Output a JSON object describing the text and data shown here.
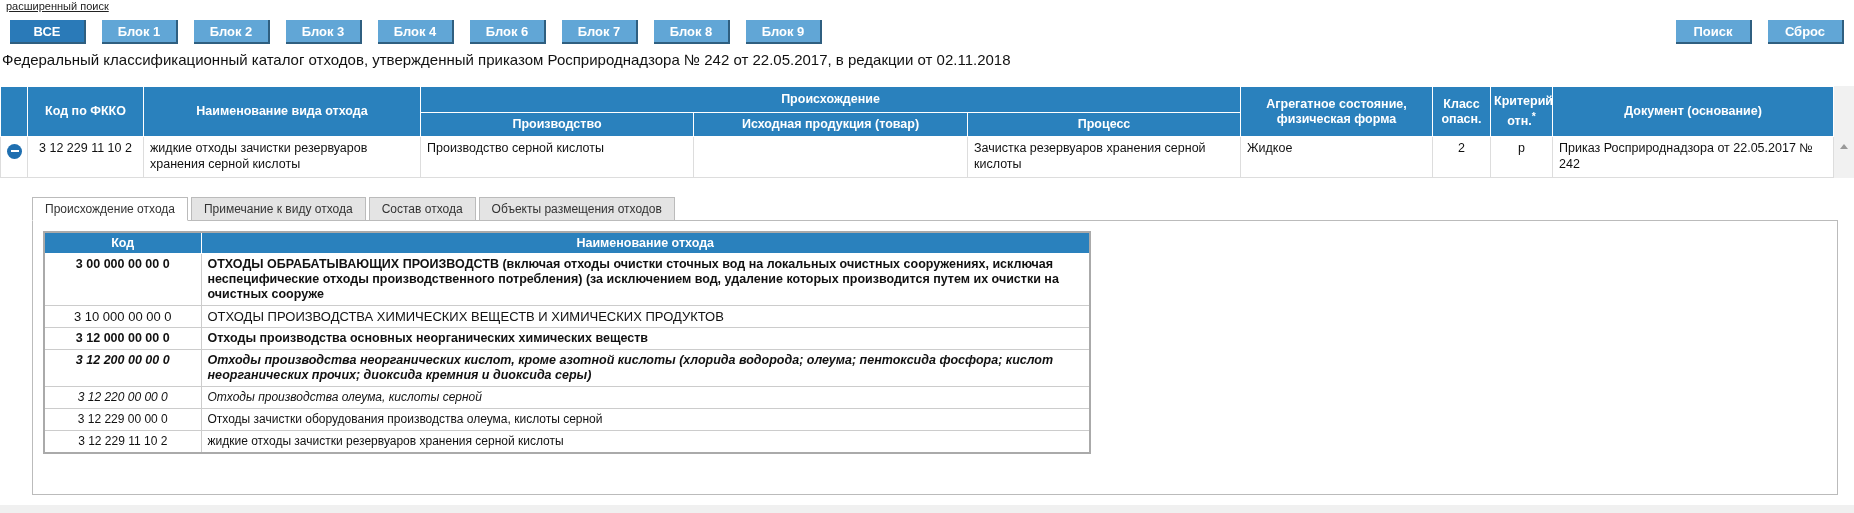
{
  "advanced_search_link": "расширенный поиск",
  "block_buttons": [
    {
      "label": "ВСЕ",
      "selected": true
    },
    {
      "label": "Блок 1",
      "selected": false
    },
    {
      "label": "Блок 2",
      "selected": false
    },
    {
      "label": "Блок 3",
      "selected": false
    },
    {
      "label": "Блок 4",
      "selected": false
    },
    {
      "label": "Блок 6",
      "selected": false
    },
    {
      "label": "Блок 7",
      "selected": false
    },
    {
      "label": "Блок 8",
      "selected": false
    },
    {
      "label": "Блок 9",
      "selected": false
    }
  ],
  "action_buttons": [
    "Поиск",
    "Сброс"
  ],
  "catalog_title": "Федеральный классификационный каталог отходов, утвержденный приказом Росприроднадзора № 242 от 22.05.2017, в редакции от 02.11.2018",
  "main_table": {
    "columns": {
      "code": "Код по ФККО",
      "name": "Наименование вида отхода",
      "origin": "Происхождение",
      "origin_sub": [
        "Производство",
        "Исходная продукция (товар)",
        "Процесс"
      ],
      "state": "Агрегатное состояние, физическая форма",
      "hazard_class": "Класс опасн.",
      "criterion": "Критерий отн.$^{*}$",
      "document": "Документ (основание)"
    },
    "rows": [
      {
        "expanded": true,
        "code": "3 12 229 11 10 2",
        "name": "жидкие отходы зачистки резервуаров хранения серной кислоты",
        "production": "Производство серной кислоты",
        "process": "Зачистка резервуаров хранения серной кислоты",
        "state": "Жидкое",
        "hazard_class": "2",
        "criterion": "р",
        "document": "Приказ Росприроднадзора от 22.05.2017 № 242"
      }
    ]
  },
  "detail_tabs": [
    {
      "label": "Происхождение отхода",
      "selected": true
    },
    {
      "label": "Примечание к виду отхода",
      "selected": false
    },
    {
      "label": "Состав отхода",
      "selected": false
    },
    {
      "label": "Объекты размещения отходов",
      "selected": false
    }
  ],
  "origin_table": {
    "columns": [
      "Код",
      "Наименование отхода"
    ],
    "rows": [
      {
        "kind": "bold",
        "code": "3 00 000 00 00 0",
        "name": "ОТХОДЫ ОБРАБАТЫВАЮЩИХ ПРОИЗВОДСТВ (включая отходы очистки сточных вод на локальных очистных сооружениях, исключая неспецифические отходы производственного потребления) (за исключением вод, удаление которых производится путем их очистки на очистных сооруже"
      },
      {
        "kind": "large",
        "code": "3 10 000 00 00 0",
        "name": "ОТХОДЫ ПРОИЗВОДСТВА ХИМИЧЕСКИХ ВЕЩЕСТВ И ХИМИЧЕСКИХ ПРОДУКТОВ"
      },
      {
        "kind": "bold",
        "code": "3 12 000 00 00 0",
        "name": "Отходы производства основных неорганических химических веществ"
      },
      {
        "kind": "bold-italic",
        "code": "3 12 200 00 00 0",
        "name": "Отходы производства неорганических кислот, кроме азотной кислоты (хлорида водорода; олеума; пентоксида фосфора; кислот неорганических прочих; диоксида кремния и диоксида серы)"
      },
      {
        "kind": "italic",
        "code": "3 12 220 00 00 0",
        "name": "Отходы производства олеума, кислоты серной"
      },
      {
        "kind": "plain",
        "code": "3 12 229 00 00 0",
        "name": "Отходы зачистки оборудования производства олеума, кислоты серной"
      },
      {
        "kind": "plain",
        "code": "3 12 229 11 10 2",
        "name": "жидкие отходы зачистки резервуаров хранения серной кислоты"
      }
    ]
  }
}
